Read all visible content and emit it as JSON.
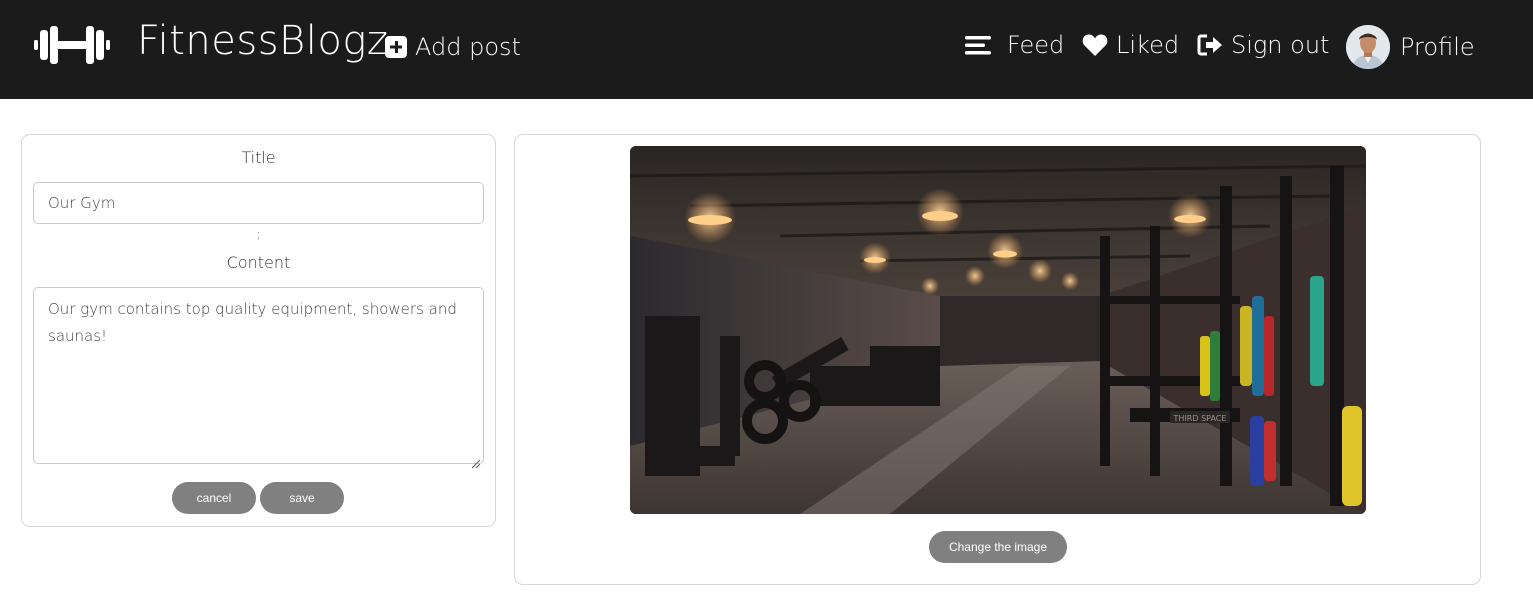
{
  "header": {
    "brand": "FitnessBlogz",
    "logo_icon": "dumbbell-icon",
    "add_post": {
      "label": "Add post",
      "icon": "plus-square-icon"
    },
    "feed": {
      "label": "Feed",
      "icon": "menu-lines-icon"
    },
    "liked": {
      "label": "Liked",
      "icon": "heart-icon"
    },
    "sign_out": {
      "label": "Sign out",
      "icon": "sign-out-icon"
    },
    "profile": {
      "label": "Profile",
      "icon": "avatar"
    }
  },
  "form": {
    "title_label": "Title",
    "title_value": "Our Gym",
    "separator": ";",
    "content_label": "Content",
    "content_value": "Our gym contains top quality equipment, showers and saunas!",
    "cancel_label": "cancel",
    "save_label": "save"
  },
  "image_panel": {
    "change_label": "Change the image"
  },
  "colors": {
    "navbar_bg": "#1b1b1b",
    "button_bg": "#808080",
    "card_border": "#d6d6d6"
  }
}
